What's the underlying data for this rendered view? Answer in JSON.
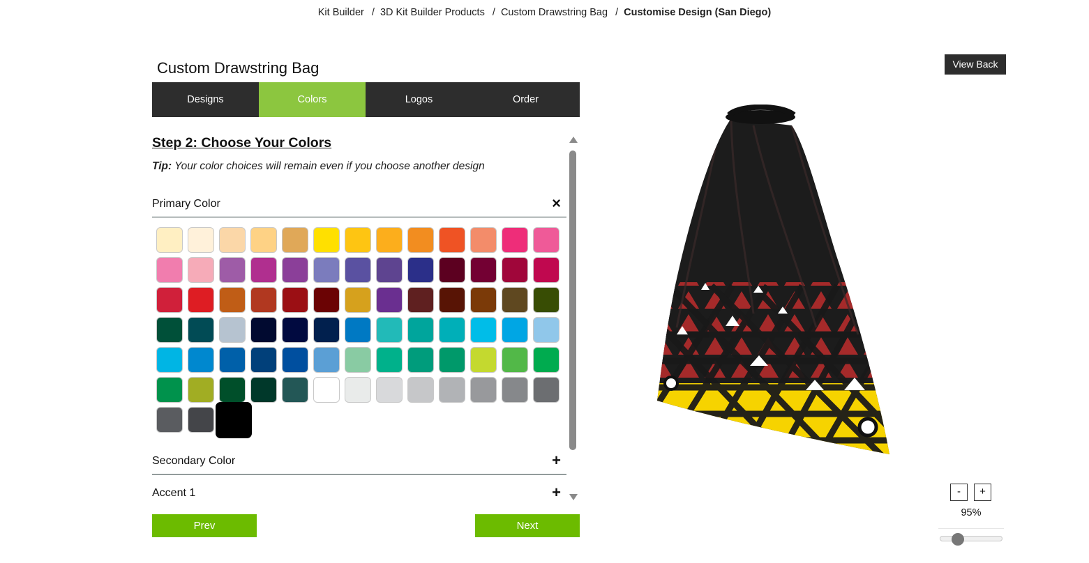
{
  "breadcrumb": {
    "items": [
      "Kit Builder",
      "3D Kit Builder Products",
      "Custom Drawstring Bag"
    ],
    "current": "Customise Design (San Diego)",
    "separator": "/"
  },
  "page_title": "Custom Drawstring Bag",
  "tabs": [
    {
      "label": "Designs",
      "active": false
    },
    {
      "label": "Colors",
      "active": true
    },
    {
      "label": "Logos",
      "active": false
    },
    {
      "label": "Order",
      "active": false
    }
  ],
  "step": {
    "title": "Step 2: Choose Your Colors",
    "tip_label": "Tip:",
    "tip_text": " Your color choices will remain even if you choose another design"
  },
  "sections": {
    "primary": {
      "label": "Primary Color",
      "toggle": "×",
      "expanded": true
    },
    "secondary": {
      "label": "Secondary Color",
      "toggle": "+",
      "expanded": false
    },
    "accent1": {
      "label": "Accent 1",
      "toggle": "+",
      "expanded": false
    }
  },
  "swatches": [
    "#FFEFC2",
    "#FFF1DA",
    "#FBD7A8",
    "#FED285",
    "#E0A858",
    "#FFE000",
    "#FEC512",
    "#FCAE1C",
    "#F28D20",
    "#EF5324",
    "#F38C6A",
    "#EE2D79",
    "#EF5A98",
    "#F17DAE",
    "#F6ABB8",
    "#9E5CA7",
    "#B02F8F",
    "#8B3F99",
    "#7B7CBD",
    "#5A51A1",
    "#5E4490",
    "#2B2F89",
    "#5C0020",
    "#730033",
    "#A0063A",
    "#C0084F",
    "#D0203A",
    "#DE1D23",
    "#C05D16",
    "#B13820",
    "#9B0F14",
    "#6B0304",
    "#D6A11D",
    "#6A2F90",
    "#5F2020",
    "#581405",
    "#7B3A08",
    "#5F4820",
    "#384D04",
    "#005039",
    "#014B55",
    "#B6C3D0",
    "#010A30",
    "#010A40",
    "#01204E",
    "#0079C3",
    "#22BAB8",
    "#00A59C",
    "#00AFB8",
    "#00BDE8",
    "#00A6E4",
    "#90C7EA",
    "#00B5E4",
    "#0088CF",
    "#0060A9",
    "#01407A",
    "#004F9F",
    "#5B9FD5",
    "#89CBA3",
    "#00B18B",
    "#009C7C",
    "#00996A",
    "#C4D92F",
    "#52B848",
    "#00AB4F",
    "#00924C",
    "#A1AD23",
    "#004F2A",
    "#00382A",
    "#235756",
    "#FFFFFF",
    "#E9EBEA",
    "#D8D9DB",
    "#C6C7C9",
    "#B1B3B6",
    "#98999C",
    "#86888B",
    "#6C6E71",
    "#5A5C60",
    "#444549",
    "#000000"
  ],
  "selected_swatch": "#000000",
  "buttons": {
    "prev": "Prev",
    "next": "Next",
    "view_back": "View Back"
  },
  "zoom": {
    "minus": "-",
    "plus": "+",
    "level_text": "95%",
    "level": 0.95
  },
  "bag_colors": {
    "body": "#1c1c1c",
    "red": "#a52a2a",
    "yellow": "#f6d300",
    "accent": "#8cc63f",
    "button": "#6cbb00"
  }
}
